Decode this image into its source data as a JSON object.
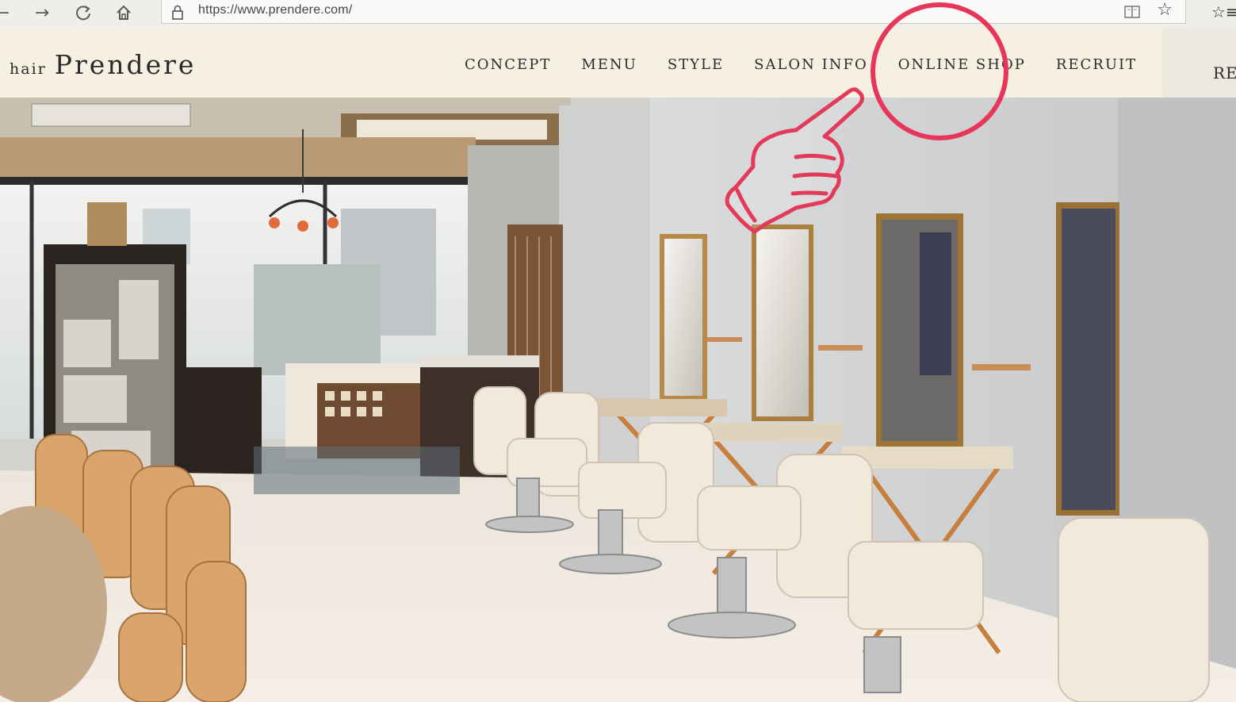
{
  "browser": {
    "url": "https://www.prendere.com/",
    "icons": [
      "back-icon",
      "forward-icon",
      "refresh-icon",
      "home-icon",
      "lock-icon",
      "reader-view-icon",
      "star-icon",
      "favorites-icon"
    ]
  },
  "site": {
    "logo_prefix": "hair",
    "logo_name": "Prendere",
    "nav": [
      {
        "label": "CONCEPT"
      },
      {
        "label": "MENU"
      },
      {
        "label": "STYLE"
      },
      {
        "label": "SALON INFO"
      },
      {
        "label": "ONLINE SHOP"
      },
      {
        "label": "RECRUIT"
      }
    ],
    "nav_icon": "instagram-icon",
    "cut_off_label": "RE"
  },
  "hero": {
    "description_icon": "salon-interior-photo"
  },
  "annotation": {
    "target": "ONLINE SHOP",
    "circle_color": "#e8365a",
    "hand_color": "#e23a58",
    "icon": "pointing-hand-icon"
  }
}
